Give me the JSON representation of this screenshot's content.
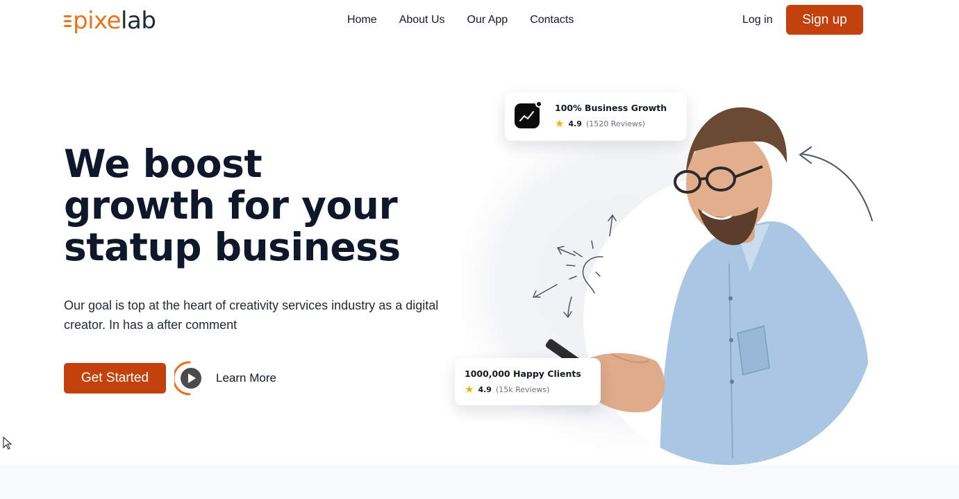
{
  "header": {
    "logo": {
      "part1": "pixe",
      "part2": "lab"
    },
    "nav": [
      {
        "label": "Home"
      },
      {
        "label": "About Us"
      },
      {
        "label": "Our App"
      },
      {
        "label": "Contacts"
      }
    ],
    "login_label": "Log in",
    "signup_label": "Sign up"
  },
  "hero": {
    "title_lines": [
      "We boost",
      "growth for your",
      "statup business"
    ],
    "description": "Our goal is top at the heart of creativity services industry as a digital creator. In has a after comment",
    "get_started_label": "Get Started",
    "learn_more_label": "Learn More"
  },
  "cards": {
    "growth": {
      "title": "100% Business Growth",
      "rating": "4.9",
      "reviews": "(1520 Reviews)"
    },
    "clients": {
      "title": "1000,000 Happy Clients",
      "rating": "4.9",
      "reviews": "(15k Reviews)"
    }
  },
  "colors": {
    "accent": "#c2410c",
    "logo_orange": "#e8741e",
    "heading": "#0f172a",
    "star": "#f5b301"
  },
  "icons": [
    "trend-chart-icon",
    "star-icon",
    "play-icon",
    "arrow-icon",
    "lightbulb-icon",
    "mouse-cursor-icon"
  ]
}
